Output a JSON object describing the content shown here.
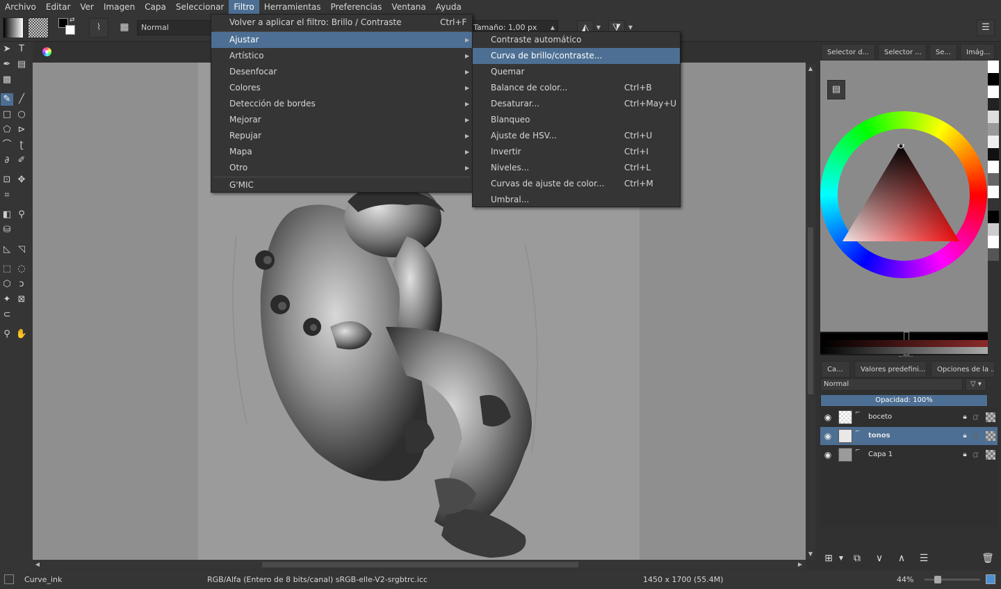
{
  "menubar": [
    "Archivo",
    "Editar",
    "Ver",
    "Imagen",
    "Capa",
    "Seleccionar",
    "Filtro",
    "Herramientas",
    "Preferencias",
    "Ventana",
    "Ayuda"
  ],
  "toolbar": {
    "blend_mode": "Normal",
    "size_label": "Tamaño:",
    "size_value": "1,00 px"
  },
  "filter_menu": {
    "reapply_label": "Volver a aplicar el filtro: Brillo / Contraste",
    "reapply_shortcut": "Ctrl+F",
    "items": [
      "Ajustar",
      "Artístico",
      "Desenfocar",
      "Colores",
      "Detección de bordes",
      "Mejorar",
      "Repujar",
      "Mapa",
      "Otro"
    ],
    "gmic_label": "G'MIC"
  },
  "adjust_menu": {
    "items": [
      {
        "label": "Contraste automático",
        "shortcut": ""
      },
      {
        "label": "Curva de brillo/contraste...",
        "shortcut": ""
      },
      {
        "label": "Quemar",
        "shortcut": ""
      },
      {
        "label": "Balance de color...",
        "shortcut": "Ctrl+B"
      },
      {
        "label": "Desaturar...",
        "shortcut": "Ctrl+May+U"
      },
      {
        "label": "Blanqueo",
        "shortcut": ""
      },
      {
        "label": "Ajuste de HSV...",
        "shortcut": "Ctrl+U"
      },
      {
        "label": "Invertir",
        "shortcut": "Ctrl+I"
      },
      {
        "label": "Niveles...",
        "shortcut": "Ctrl+L"
      },
      {
        "label": "Curvas de ajuste de color...",
        "shortcut": "Ctrl+M"
      },
      {
        "label": "Umbral...",
        "shortcut": ""
      }
    ]
  },
  "docker": {
    "top_tabs": [
      "Selector d...",
      "Selector ...",
      "Se...",
      "Imág..."
    ],
    "layer_tabs": [
      "Ca...",
      "Valores predefini...",
      "Opciones de la ..."
    ],
    "blend_mode": "Normal",
    "opacity_label": "Opacidad:  100%",
    "layers": [
      {
        "name": "boceto",
        "active": false
      },
      {
        "name": "tonos",
        "active": true
      },
      {
        "name": "Capa 1",
        "active": false
      }
    ]
  },
  "statusbar": {
    "brush": "Curve_ink",
    "color_info": "RGB/Alfa (Entero de 8 bits/canal)  sRGB-elle-V2-srgbtrc.icc",
    "dimensions": "1450 x 1700 (55.4M)",
    "zoom": "44%"
  },
  "colors": {
    "accent": "#4d6f93",
    "panel": "#353535",
    "canvas": "#8f8f8f"
  },
  "icons": {
    "tools": [
      "select-arrow-icon",
      "text-icon",
      "calligraphy-icon",
      "gradient-icon",
      "brush-icon",
      "line-icon",
      "rectangle-icon",
      "ellipse-icon",
      "polygon-icon",
      "polyline-icon",
      "bezier-icon",
      "freehand-path-icon",
      "dynamic-brush-icon",
      "multibrush-icon",
      "transform-icon",
      "move-icon",
      "crop-icon",
      "fill-gradient-icon",
      "eyedropper-icon",
      "fill-bucket-icon",
      "measure-icon",
      "assistant-icon",
      "rect-select-icon",
      "ellipse-select-icon",
      "poly-select-icon",
      "freehand-select-icon",
      "magic-wand-icon",
      "similar-select-icon",
      "bezier-select-icon",
      "zoom-icon",
      "pan-icon"
    ]
  }
}
